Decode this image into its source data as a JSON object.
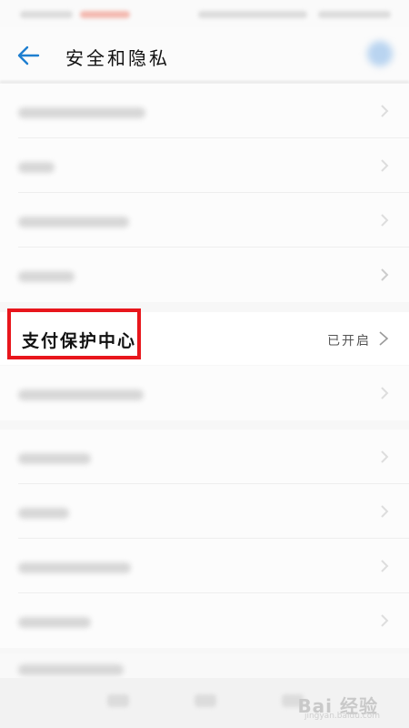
{
  "header": {
    "title": "安全和隐私"
  },
  "payment_protection": {
    "label": "支付保护中心",
    "status": "已开启"
  },
  "watermark": {
    "brand": "Bai 经验",
    "sub": "jingyan.baidu.com"
  },
  "colors": {
    "accent": "#1e7fd0",
    "highlight": "#e8161c"
  }
}
